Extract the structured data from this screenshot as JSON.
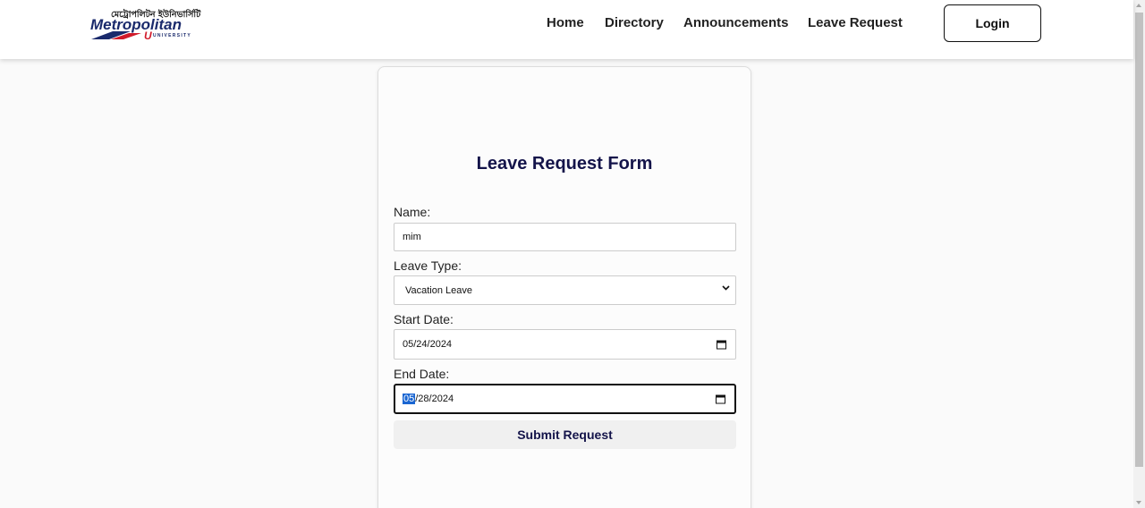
{
  "header": {
    "logo": {
      "bangla_text": "মেট্রোপলিটন ইউনিভার্সিটি",
      "name": "Metropolitan",
      "sub": "UNIVERSITY"
    },
    "nav": [
      "Home",
      "Directory",
      "Announcements",
      "Leave Request"
    ],
    "login_label": "Login"
  },
  "form": {
    "title": "Leave Request Form",
    "name_label": "Name:",
    "name_value": "mim",
    "leave_type_label": "Leave Type:",
    "leave_type_value": "Vacation Leave",
    "start_date_label": "Start Date:",
    "start_date_value": "05/24/2024",
    "end_date_label": "End Date:",
    "end_date_month": "05",
    "end_date_rest": "/28/2024",
    "submit_label": "Submit Request"
  },
  "colors": {
    "title": "#14144a",
    "accent_selection": "#1a66d2",
    "logo_blue": "#1a2a6c",
    "logo_red": "#d11a2a"
  }
}
